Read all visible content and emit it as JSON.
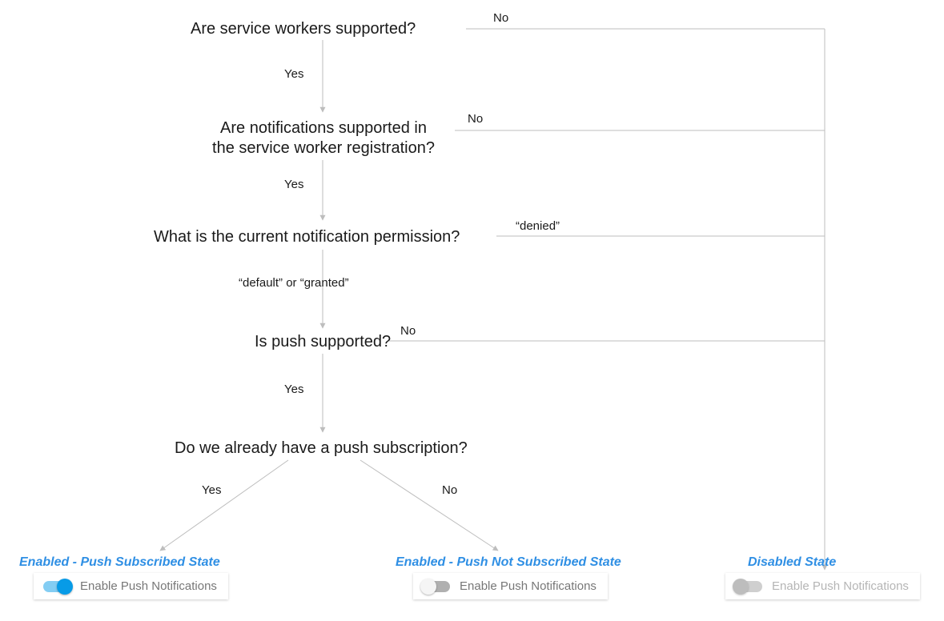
{
  "questions": {
    "q1": "Are service workers supported?",
    "q2_line1": "Are notifications supported in",
    "q2_line2": "the service worker registration?",
    "q3": "What is the current notification permission?",
    "q4": "Is push supported?",
    "q5": "Do we already have a push subscription?"
  },
  "edges": {
    "no": "No",
    "yes": "Yes",
    "denied": "“denied”",
    "default_or_granted": "“default” or “granted”"
  },
  "states": {
    "enabled_subscribed": "Enabled - Push Subscribed State",
    "enabled_not_subscribed": "Enabled - Push Not Subscribed State",
    "disabled": "Disabled State"
  },
  "toggles": {
    "label": "Enable Push Notifications"
  }
}
